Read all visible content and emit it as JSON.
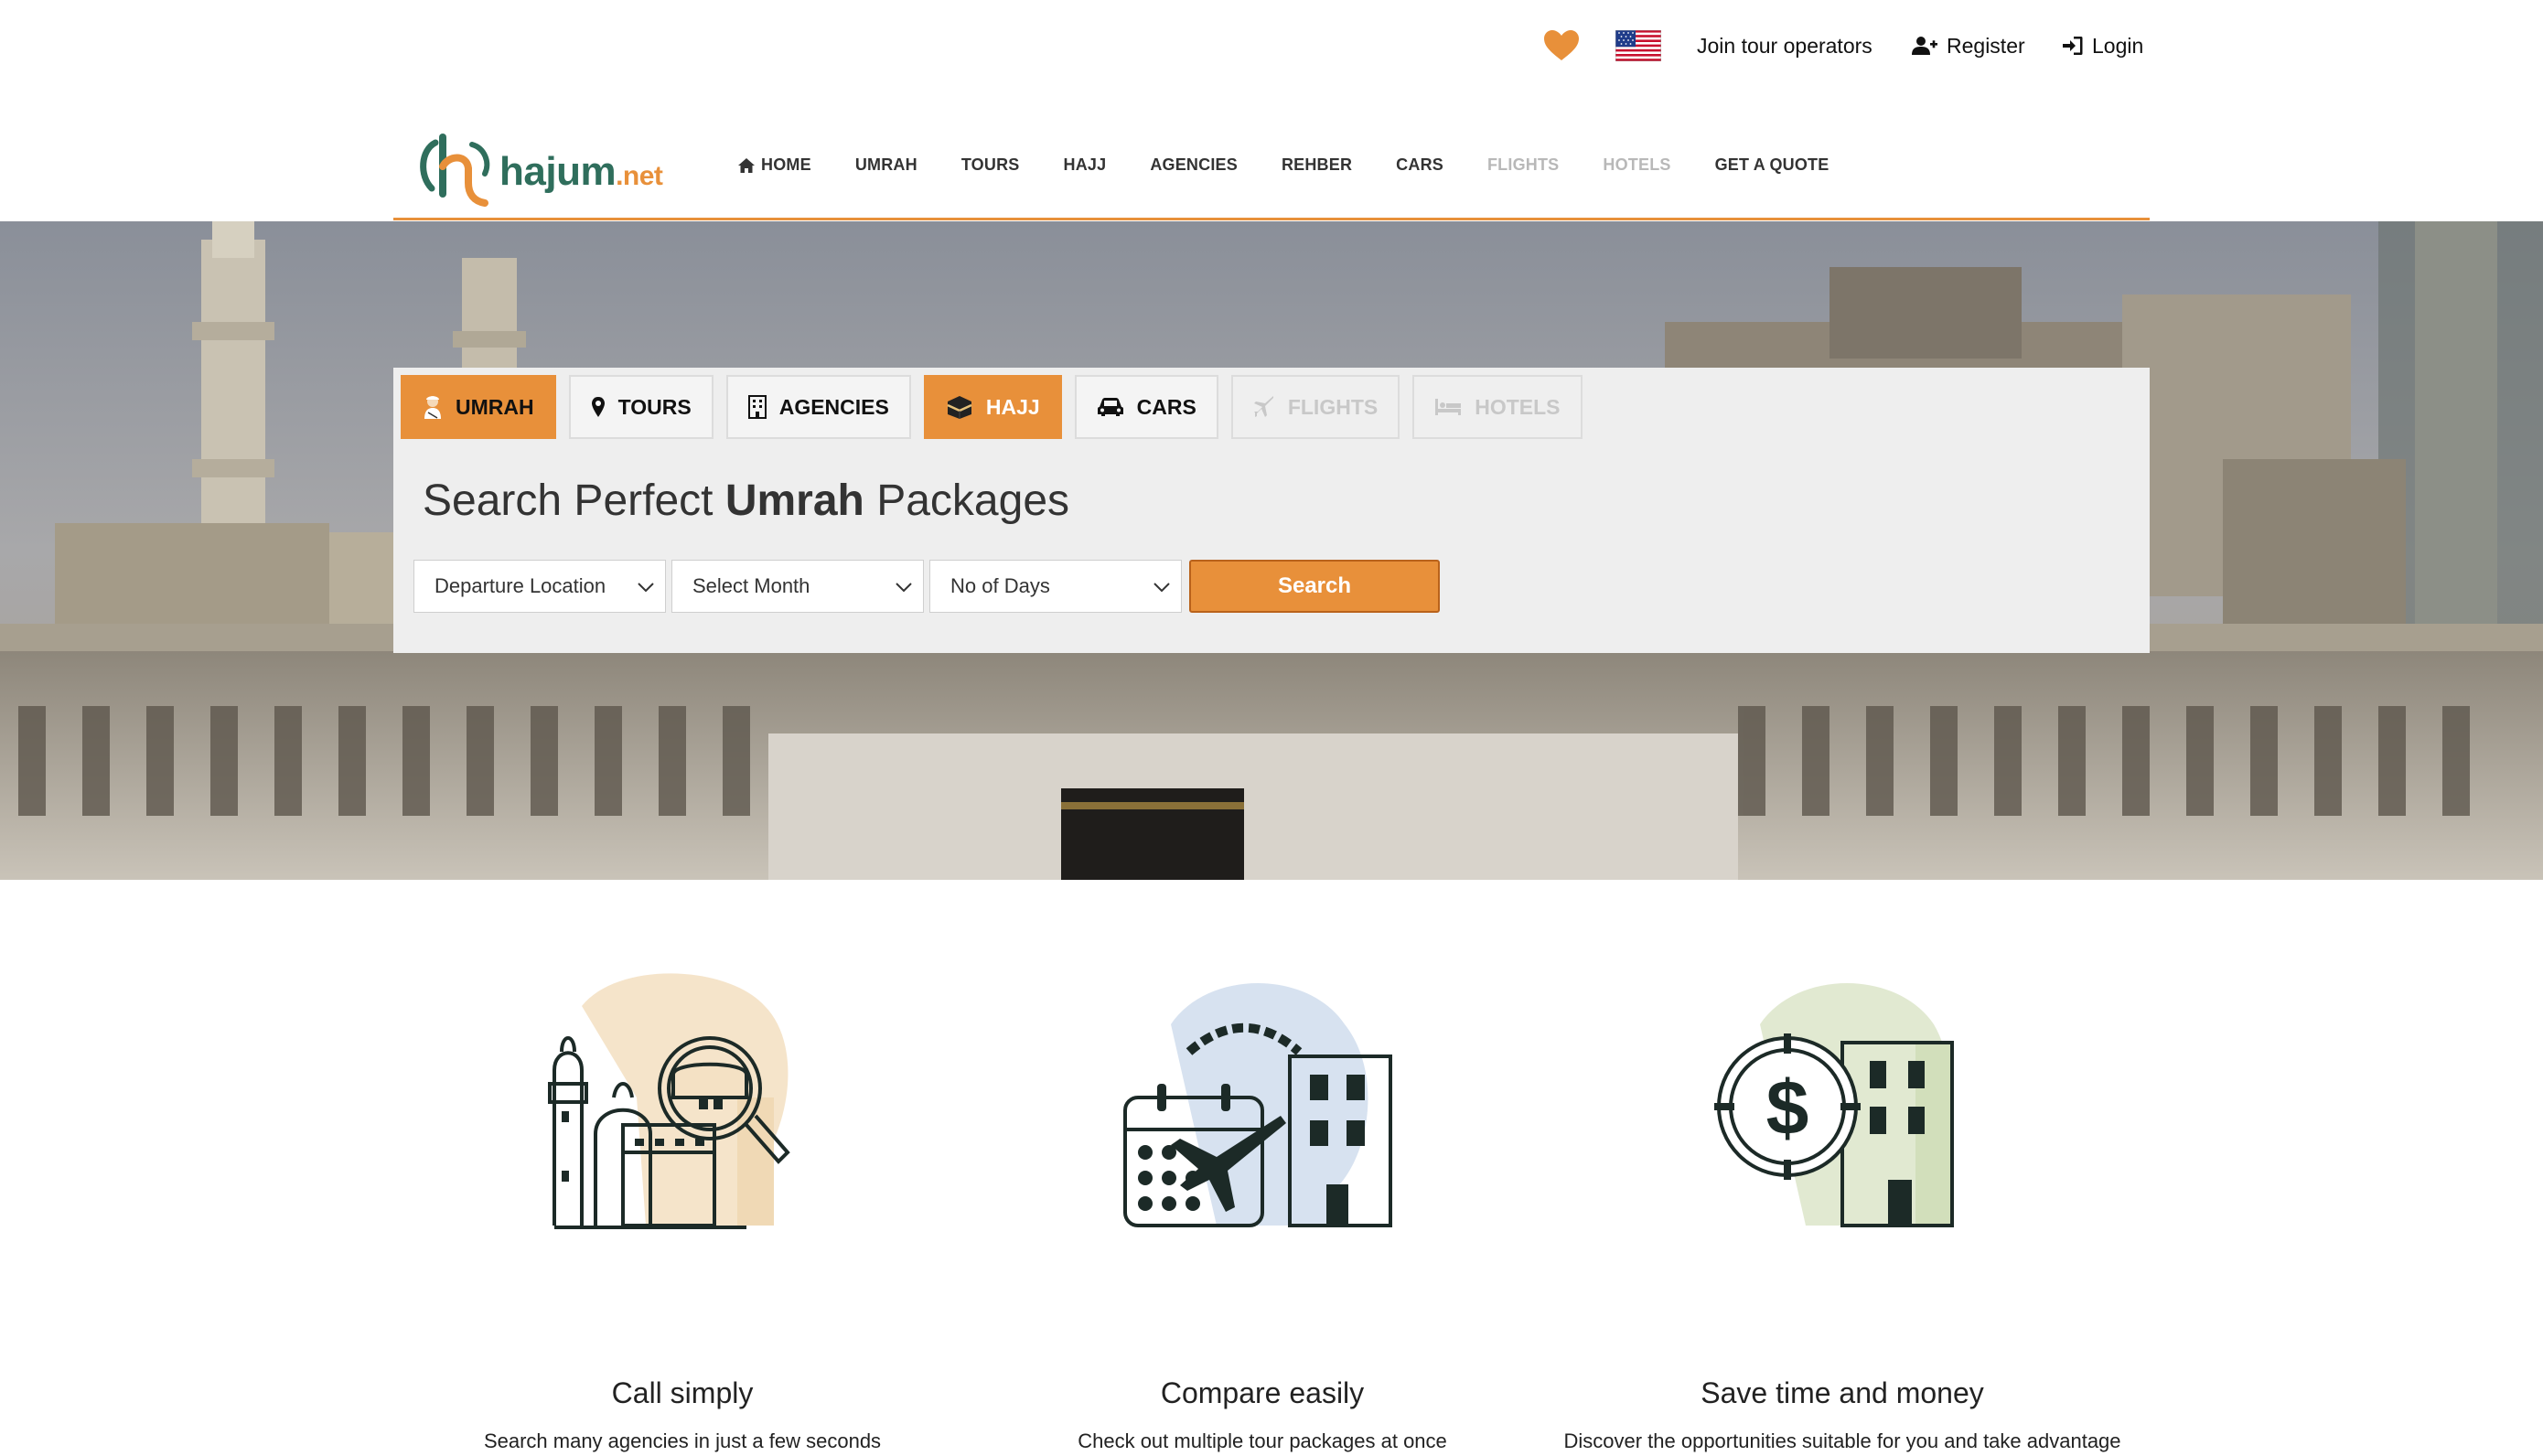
{
  "topbar": {
    "favorites_icon": "heart-icon",
    "language_icon": "us-flag-icon",
    "join_label": "Join tour operators",
    "register_label": "Register",
    "login_label": "Login"
  },
  "brand": {
    "logo_text": "hajum",
    "logo_tld": ".net",
    "accent_color": "#e8903a",
    "brand_color": "#2f6e5c"
  },
  "nav": {
    "home": "HOME",
    "umrah": "UMRAH",
    "tours": "TOURS",
    "hajj": "HAJJ",
    "agencies": "AGENCIES",
    "rehber": "REHBER",
    "cars": "CARS",
    "flights": "FLIGHTS",
    "hotels": "HOTELS",
    "quote": "GET A QUOTE"
  },
  "search": {
    "tabs": {
      "umrah": "UMRAH",
      "tours": "TOURS",
      "agencies": "AGENCIES",
      "hajj": "HAJJ",
      "cars": "CARS",
      "flights": "FLIGHTS",
      "hotels": "HOTELS"
    },
    "title_prefix": "Search Perfect ",
    "title_bold": "Umrah",
    "title_suffix": " Packages",
    "departure": "Departure Location",
    "month": "Select Month",
    "days": "No of Days",
    "button": "Search"
  },
  "features": [
    {
      "title": "Call simply",
      "desc": "Search many agencies in just a few seconds"
    },
    {
      "title": "Compare easily",
      "desc": "Check out multiple tour packages at once"
    },
    {
      "title": "Save time and money",
      "desc": "Discover the opportunities suitable for you and take advantage"
    }
  ]
}
